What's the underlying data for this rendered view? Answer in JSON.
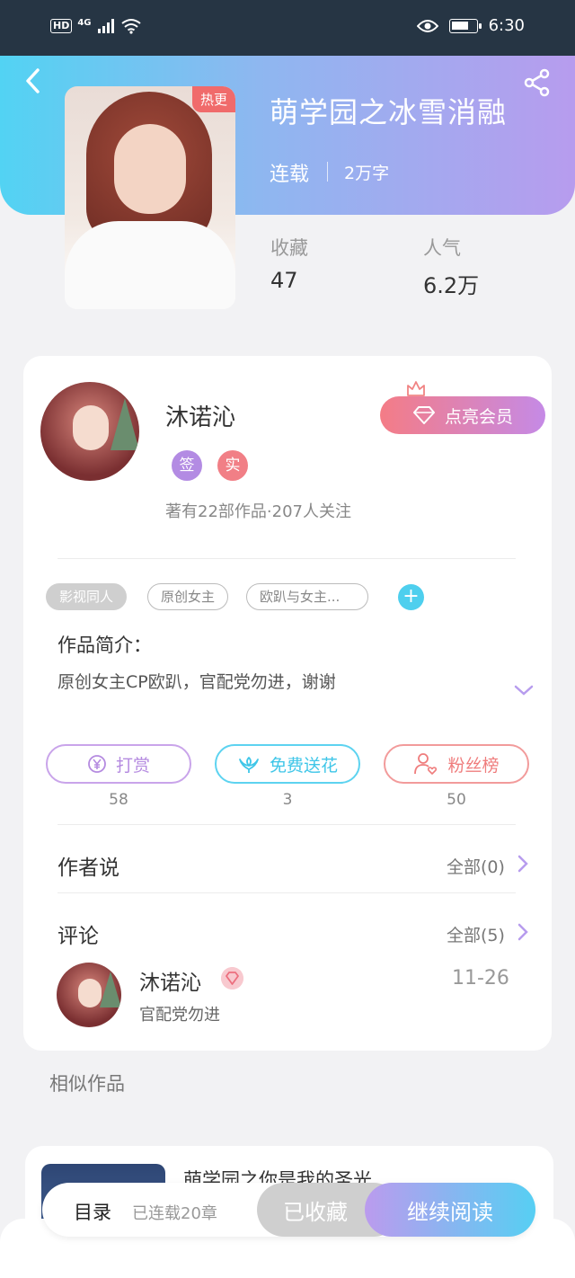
{
  "status_bar": {
    "hd": "HD",
    "network": "4G",
    "time": "6:30"
  },
  "book": {
    "title": "萌学园之冰雪消融",
    "hot_tag": "热更",
    "status": "连载",
    "word_count": "2万字",
    "stats": [
      {
        "label": "收藏",
        "value": "47"
      },
      {
        "label": "人气",
        "value": "6.2万"
      }
    ]
  },
  "author": {
    "name": "沐诺沁",
    "badges": [
      "签",
      "实"
    ],
    "meta": "著有22部作品·207人关注",
    "vip_button": "点亮会员"
  },
  "tags": [
    {
      "label": "影视同人"
    },
    {
      "label": "原创女主"
    },
    {
      "label": "欧趴与女主..."
    }
  ],
  "intro": {
    "title": "作品简介：",
    "text": "原创女主CP欧趴，官配党勿进，谢谢"
  },
  "actions": [
    {
      "label": "打赏",
      "count": "58",
      "color": "#b58be0"
    },
    {
      "label": "免费送花",
      "count": "3",
      "color": "#4ecfee"
    },
    {
      "label": "粉丝榜",
      "count": "50",
      "color": "#f08484"
    }
  ],
  "author_says": {
    "title": "作者说",
    "link": "全部(0)"
  },
  "comments": {
    "title": "评论",
    "link": "全部(5)",
    "items": [
      {
        "name": "沐诺沁",
        "date": "11-26",
        "text": "官配党勿进"
      }
    ]
  },
  "similar": {
    "title": "相似作品",
    "items": [
      {
        "title": "萌学园之你是我的圣光"
      }
    ]
  },
  "bottom_bar": {
    "toc_label": "目录",
    "toc_count": "已连载20章",
    "collected": "已收藏",
    "continue": "继续阅读"
  },
  "colors": {
    "accent_blue": "#4ecfee",
    "accent_purple": "#b79cee",
    "hot": "#f06b6b"
  }
}
